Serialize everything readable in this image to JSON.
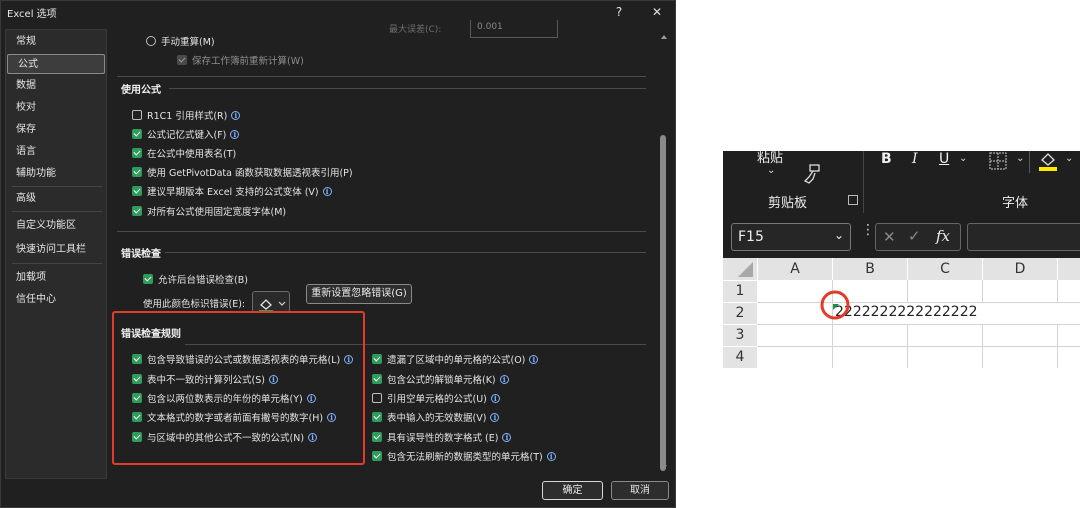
{
  "dialog": {
    "title": "Excel 选项",
    "help_label": "?",
    "close_label": "✕",
    "nav": [
      "常规",
      "公式",
      "数据",
      "校对",
      "保存",
      "语言",
      "辅助功能",
      "高级",
      "自定义功能区",
      "快速访问工具栏",
      "加载项",
      "信任中心"
    ],
    "selected_nav": "公式",
    "top": {
      "manual_recalc": "手动重算(M)",
      "save_before": "保存工作簿前重新计算(W)",
      "max_change_label": "最大误差(C):",
      "max_change_value": "0.001"
    },
    "formulas": {
      "heading": "使用公式",
      "items": [
        {
          "label": "R1C1 引用样式(R)",
          "checked": false
        },
        {
          "label": "公式记忆式键入(F)",
          "checked": true
        },
        {
          "label": "在公式中使用表名(T)",
          "checked": true
        },
        {
          "label": "使用 GetPivotData 函数获取数据透视表引用(P)",
          "checked": true
        },
        {
          "label": "建议早期版本 Excel 支持的公式变体 (V)",
          "checked": true
        },
        {
          "label": "对所有公式使用固定宽度字体(M)",
          "checked": true
        }
      ]
    },
    "error_check": {
      "heading": "错误检查",
      "enable_bg": "允许后台错误检查(B)",
      "color_label": "使用此颜色标识错误(E):",
      "reset_button": "重新设置忽略错误(G)"
    },
    "rules": {
      "heading": "错误检查规则",
      "left": [
        {
          "label": "包含导致错误的公式或数据透视表的单元格(L)",
          "checked": true
        },
        {
          "label": "表中不一致的计算列公式(S)",
          "checked": true
        },
        {
          "label": "包含以两位数表示的年份的单元格(Y)",
          "checked": true
        },
        {
          "label": "文本格式的数字或者前面有撇号的数字(H)",
          "checked": true
        },
        {
          "label": "与区域中的其他公式不一致的公式(N)",
          "checked": true
        }
      ],
      "right": [
        {
          "label": "遗漏了区域中的单元格的公式(O)",
          "checked": true
        },
        {
          "label": "包含公式的解锁单元格(K)",
          "checked": true
        },
        {
          "label": "引用空单元格的公式(U)",
          "checked": false
        },
        {
          "label": "表中输入的无效数据(V)",
          "checked": true
        },
        {
          "label": "具有误导性的数字格式 (E)",
          "checked": true
        },
        {
          "label": "包含无法刷新的数据类型的单元格(T)",
          "checked": true
        }
      ]
    },
    "ok_button": "确定",
    "cancel_button": "取消",
    "colors": {
      "accent_check": "#2e9d5c",
      "highlight_box": "#e23b2a"
    }
  },
  "excel": {
    "paste_label": "粘贴",
    "clipboard_group": "剪贴板",
    "font_group": "字体",
    "bold": "B",
    "italic": "I",
    "underline": "U",
    "name_box": "F15",
    "fx_label": "fx",
    "columns": [
      "A",
      "B",
      "C",
      "D"
    ],
    "rows": [
      "1",
      "2",
      "3",
      "4"
    ],
    "cell_b2": "2222222222222222"
  }
}
